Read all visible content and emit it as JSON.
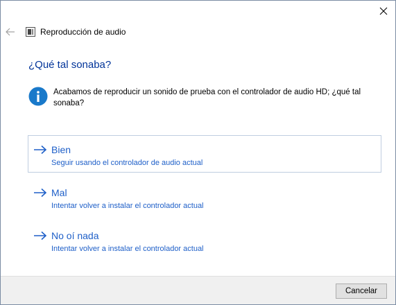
{
  "window": {
    "header_title": "Reproducción de audio"
  },
  "main": {
    "question": "¿Qué tal sonaba?",
    "info_text": "Acabamos de reproducir un sonido de prueba con el controlador de audio HD; ¿qué tal sonaba?",
    "options": [
      {
        "title": "Bien",
        "description": "Seguir usando el controlador de audio actual",
        "selected": true
      },
      {
        "title": "Mal",
        "description": "Intentar volver a instalar el controlador actual",
        "selected": false
      },
      {
        "title": "No oí nada",
        "description": "Intentar volver a instalar el controlador actual",
        "selected": false
      }
    ]
  },
  "footer": {
    "cancel_label": "Cancelar"
  },
  "colors": {
    "link_blue": "#1e5fc8",
    "heading_blue": "#003399",
    "info_blue": "#1979ca"
  },
  "icons": {
    "close": "close-icon",
    "back": "back-arrow-icon",
    "app": "audio-device-icon",
    "info": "info-icon",
    "option_arrow": "arrow-right-icon"
  }
}
